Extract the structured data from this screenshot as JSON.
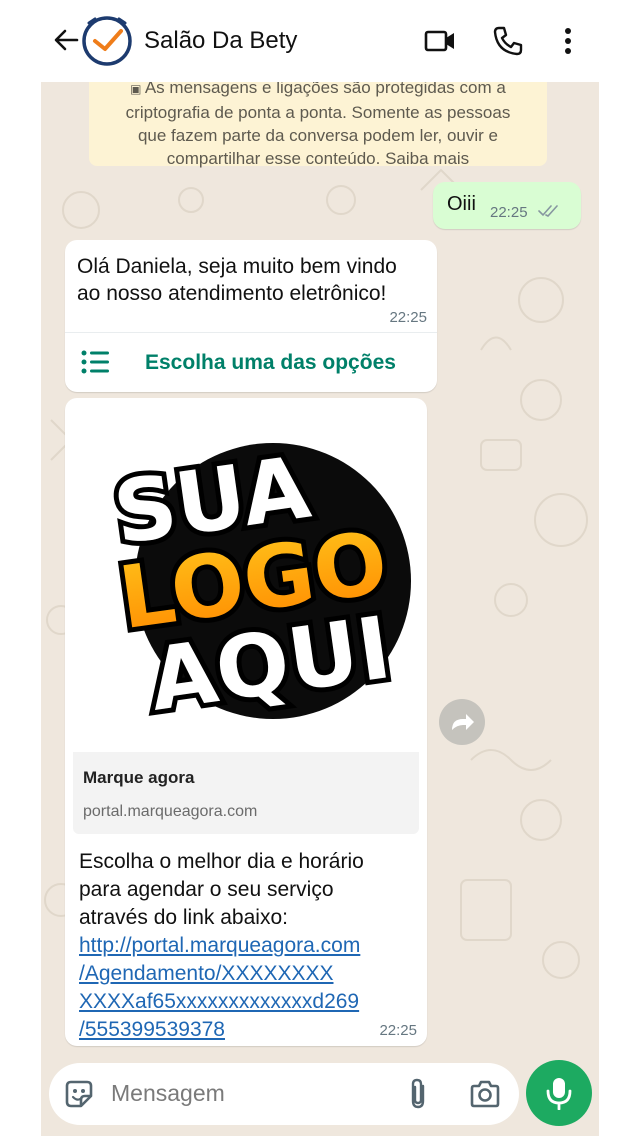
{
  "header": {
    "title": "Salão Da Bety",
    "icons": [
      "back-arrow-icon",
      "clock-logo-icon",
      "video-call-icon",
      "phone-icon",
      "more-vert-icon"
    ]
  },
  "notice": {
    "line1": "As mensagens e ligações são protegidas com a",
    "line2": "criptografia de ponta a ponta. Somente as pessoas",
    "line3": "que fazem parte da conversa podem ler, ouvir e",
    "line4": "compartilhar esse conteúdo. Saiba mais"
  },
  "messages": {
    "outgoing": {
      "text": "Oiii",
      "time": "22:25"
    },
    "welcome": {
      "line1": "Olá Daniela, seja muito bem vindo",
      "line2": "ao nosso atendimento eletrônico!",
      "time": "22:25",
      "option_label": "Escolha uma das opções"
    },
    "link_message": {
      "logo_line1": "SUA",
      "logo_line2": "LOGO",
      "logo_line3": "AQUI",
      "preview_title": "Marque agora",
      "preview_url": "portal.marqueagora.com",
      "body_line1": "Escolha o melhor dia e horário",
      "body_line2": "para agendar o seu serviço",
      "body_line3": "através do link abaixo:",
      "link_line1": "http://portal.marqueagora.com",
      "link_line2": "/Agendamento/XXXXXXXX",
      "link_line3": "XXXXaf65xxxxxxxxxxxxxd269",
      "link_line4": "/555399539378",
      "time": "22:25"
    }
  },
  "input": {
    "placeholder": "Mensagem"
  },
  "colors": {
    "accent": "#008069",
    "mic": "#1daa61",
    "outgoing_bubble": "#d9fdd3",
    "notice_bg": "#fdf3d4",
    "link": "#1f67b4"
  }
}
